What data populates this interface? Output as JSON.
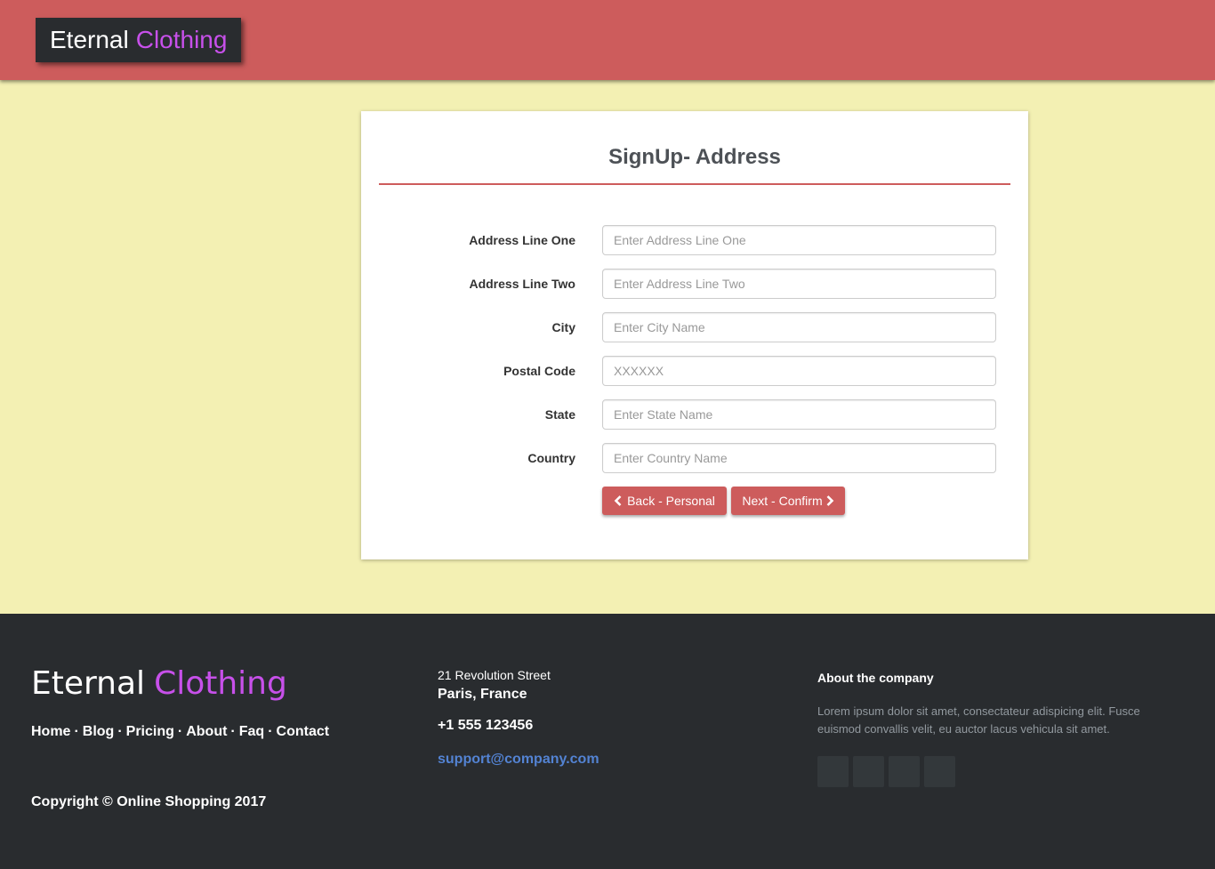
{
  "header": {
    "brand_part1": "Eternal",
    "brand_part2": "Clothing"
  },
  "form": {
    "title": "SignUp- Address",
    "fields": [
      {
        "label": "Address Line One",
        "placeholder": "Enter Address Line One",
        "value": ""
      },
      {
        "label": "Address Line Two",
        "placeholder": "Enter Address Line Two",
        "value": ""
      },
      {
        "label": "City",
        "placeholder": "Enter City Name",
        "value": ""
      },
      {
        "label": "Postal Code",
        "placeholder": "XXXXXX",
        "value": ""
      },
      {
        "label": "State",
        "placeholder": "Enter State Name",
        "value": ""
      },
      {
        "label": "Country",
        "placeholder": "Enter Country Name",
        "value": ""
      }
    ],
    "back_label": "Back - Personal",
    "next_label": "Next - Confirm",
    "back_icon": "chevron-left-icon",
    "next_icon": "chevron-right-icon"
  },
  "footer": {
    "brand_part1": "Eternal",
    "brand_part2": "Clothing",
    "links": [
      "Home",
      "Blog",
      "Pricing",
      "About",
      "Faq",
      "Contact"
    ],
    "separator": "·",
    "copyright": "Copyright © Online Shopping 2017",
    "street": "21 Revolution Street",
    "city": "Paris, France",
    "phone": "+1 555 123456",
    "email": "support@company.com",
    "about_heading": "About the company",
    "about_text": "Lorem ipsum dolor sit amet, consectateur adispicing elit. Fusce euismod convallis velit, eu auctor lacus vehicula sit amet.",
    "social_icons": [
      "social-icon-1",
      "social-icon-2",
      "social-icon-3",
      "social-icon-4"
    ]
  },
  "colors": {
    "header_bg": "#cd5c5c",
    "page_bg": "#f3f0b3",
    "footer_bg": "#292c2f",
    "brand_accent": "#c750ea",
    "button_bg": "#cd5c5c",
    "email_link": "#5383d3"
  }
}
